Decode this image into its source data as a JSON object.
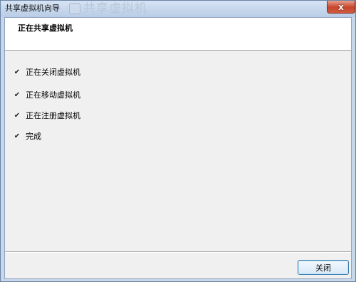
{
  "window": {
    "title": "共享虚拟机向导",
    "ghost_title": "共享虚拟机",
    "close_glyph": "x"
  },
  "header": {
    "title": "正在共享虚拟机"
  },
  "steps": [
    {
      "label": "正在关闭虚拟机",
      "done": true
    },
    {
      "label": "正在移动虚拟机",
      "done": true
    },
    {
      "label": "正在注册虚拟机",
      "done": true
    },
    {
      "label": "完成",
      "done": true
    }
  ],
  "check_glyph": "✔",
  "footer": {
    "close_label": "关闭"
  },
  "colors": {
    "accent_border": "#3c7fb1",
    "titlebar_close": "#c6452c"
  }
}
